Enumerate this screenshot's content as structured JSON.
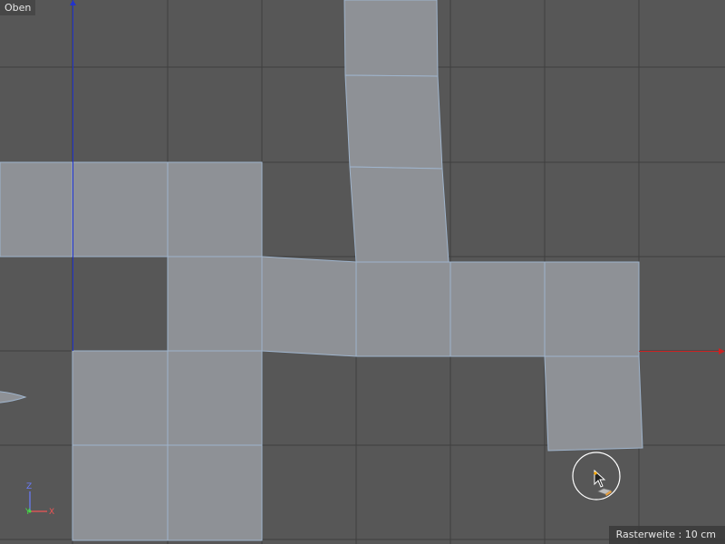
{
  "viewport": {
    "view_name": "Oben",
    "grid_spacing_text": "Rasterweite : 10 cm"
  },
  "gizmo": {
    "z_label": "Z",
    "y_label": "Y",
    "x_label": "X"
  },
  "colors": {
    "background": "#575757",
    "grid_line": "#3e3e3e",
    "polygon_fill": "#8e9196",
    "polygon_edge": "#9fb4cc",
    "x_axis": "#cc2222",
    "y_axis": "#2233cc"
  },
  "icons": [
    "brush-cursor-icon",
    "axis-gizmo-icon"
  ]
}
